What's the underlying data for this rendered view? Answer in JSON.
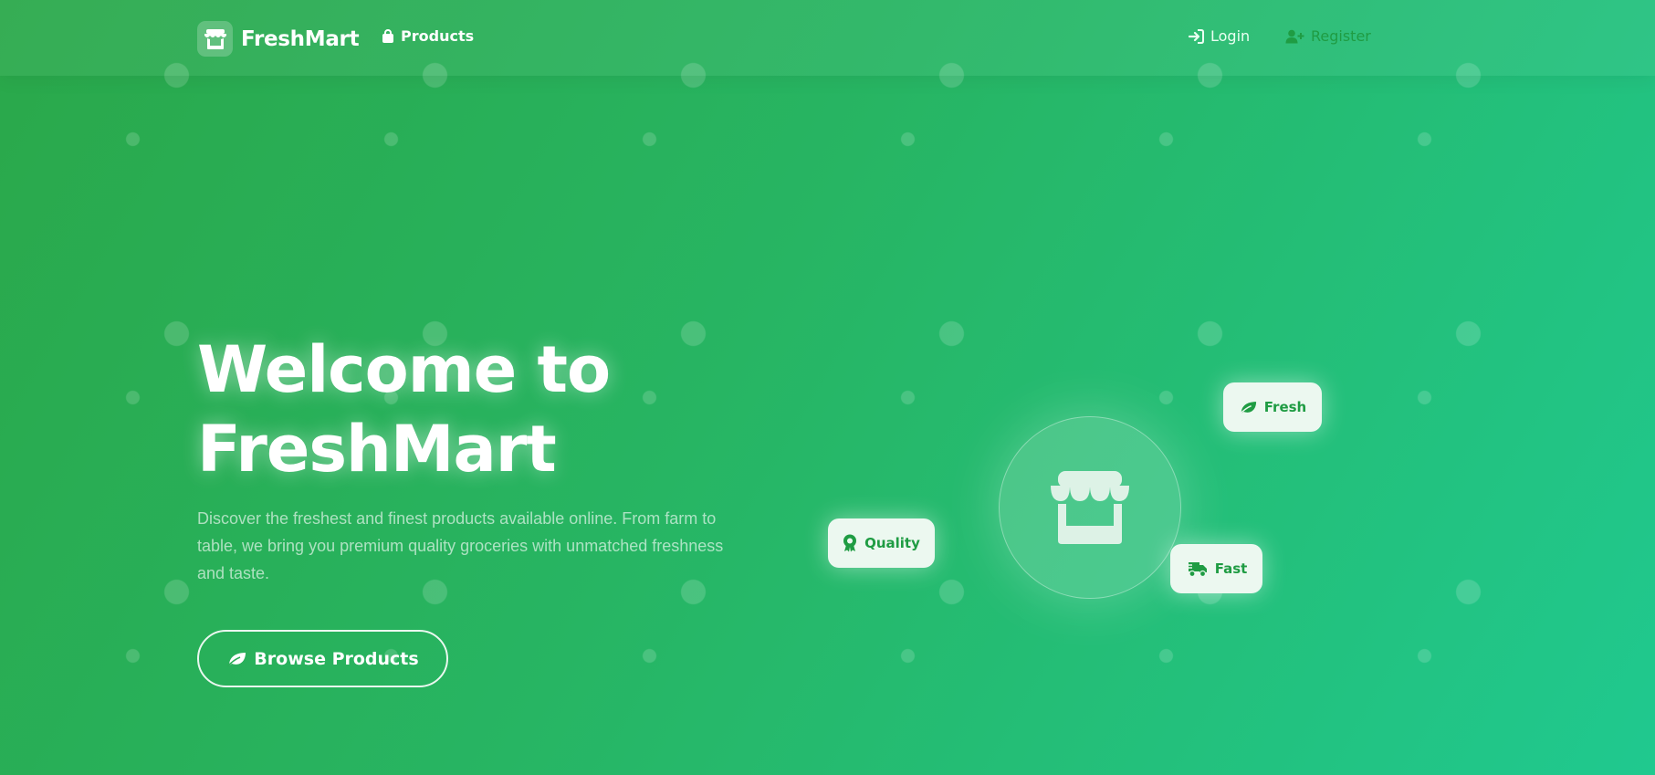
{
  "brand": {
    "name": "FreshMart",
    "logo_icon": "store-icon"
  },
  "nav": {
    "products": {
      "label": "Products",
      "icon": "shopping-bag-icon"
    },
    "login": {
      "label": "Login",
      "icon": "sign-in-icon"
    },
    "register": {
      "label": "Register",
      "icon": "user-plus-icon"
    }
  },
  "hero": {
    "title_line1": "Welcome to",
    "title_line2": "FreshMart",
    "description": "Discover the freshest and finest products available online. From farm to table, we bring you premium quality groceries with unmatched freshness and taste.",
    "cta": {
      "label": "Browse Products",
      "icon": "leaf-icon"
    }
  },
  "features": [
    {
      "label": "Fresh",
      "icon": "leaf-icon"
    },
    {
      "label": "Quality",
      "icon": "award-icon"
    },
    {
      "label": "Fast",
      "icon": "truck-icon"
    }
  ],
  "colors": {
    "gradient_start": "#2aa84a",
    "gradient_end": "#20c98f",
    "chip_background": "#ecf8f0",
    "chip_text": "#1f9c43",
    "white": "#ffffff"
  }
}
